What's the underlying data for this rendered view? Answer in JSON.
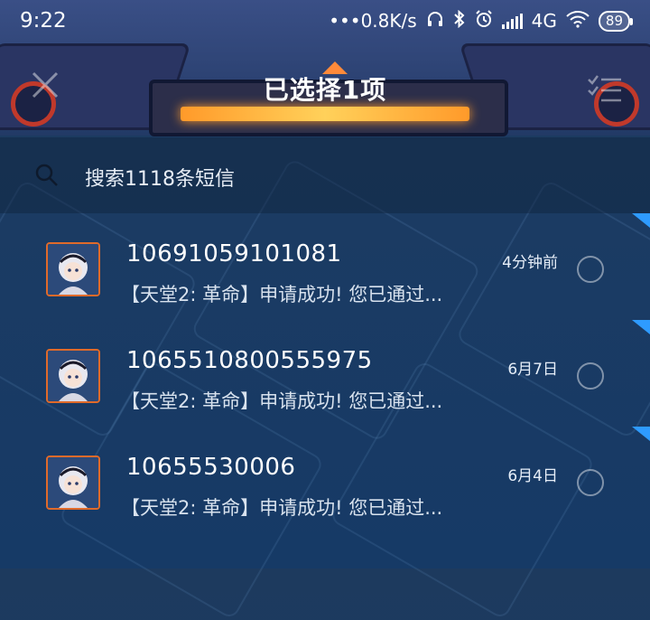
{
  "status_bar": {
    "time": "9:22",
    "network_speed": "•••0.8K/s",
    "network_type": "4G",
    "battery": "89",
    "icons": [
      "headphones-icon",
      "bluetooth-icon",
      "alarm-icon",
      "signal-icon",
      "wifi-icon",
      "battery-icon"
    ]
  },
  "title_bar": {
    "title": "已选择1项",
    "close_icon": "close-icon",
    "select_all_icon": "select-all-icon"
  },
  "search": {
    "placeholder": "搜索1118条短信",
    "icon": "search-icon"
  },
  "messages": [
    {
      "sender": "10691059101081",
      "preview": "【天堂2: 革命】申请成功! 您已通过...",
      "time": "4分钟前",
      "unread": true
    },
    {
      "sender": "1065510800555975",
      "preview": "【天堂2: 革命】申请成功! 您已通过...",
      "time": "6月7日",
      "unread": true
    },
    {
      "sender": "10655530006",
      "preview": "【天堂2: 革命】申请成功! 您已通过...",
      "time": "6月4日",
      "unread": true
    }
  ],
  "colors": {
    "accent_unread": "#2e9bff",
    "avatar_border": "#e06a2a",
    "header_glow": "#ff9a2a"
  }
}
